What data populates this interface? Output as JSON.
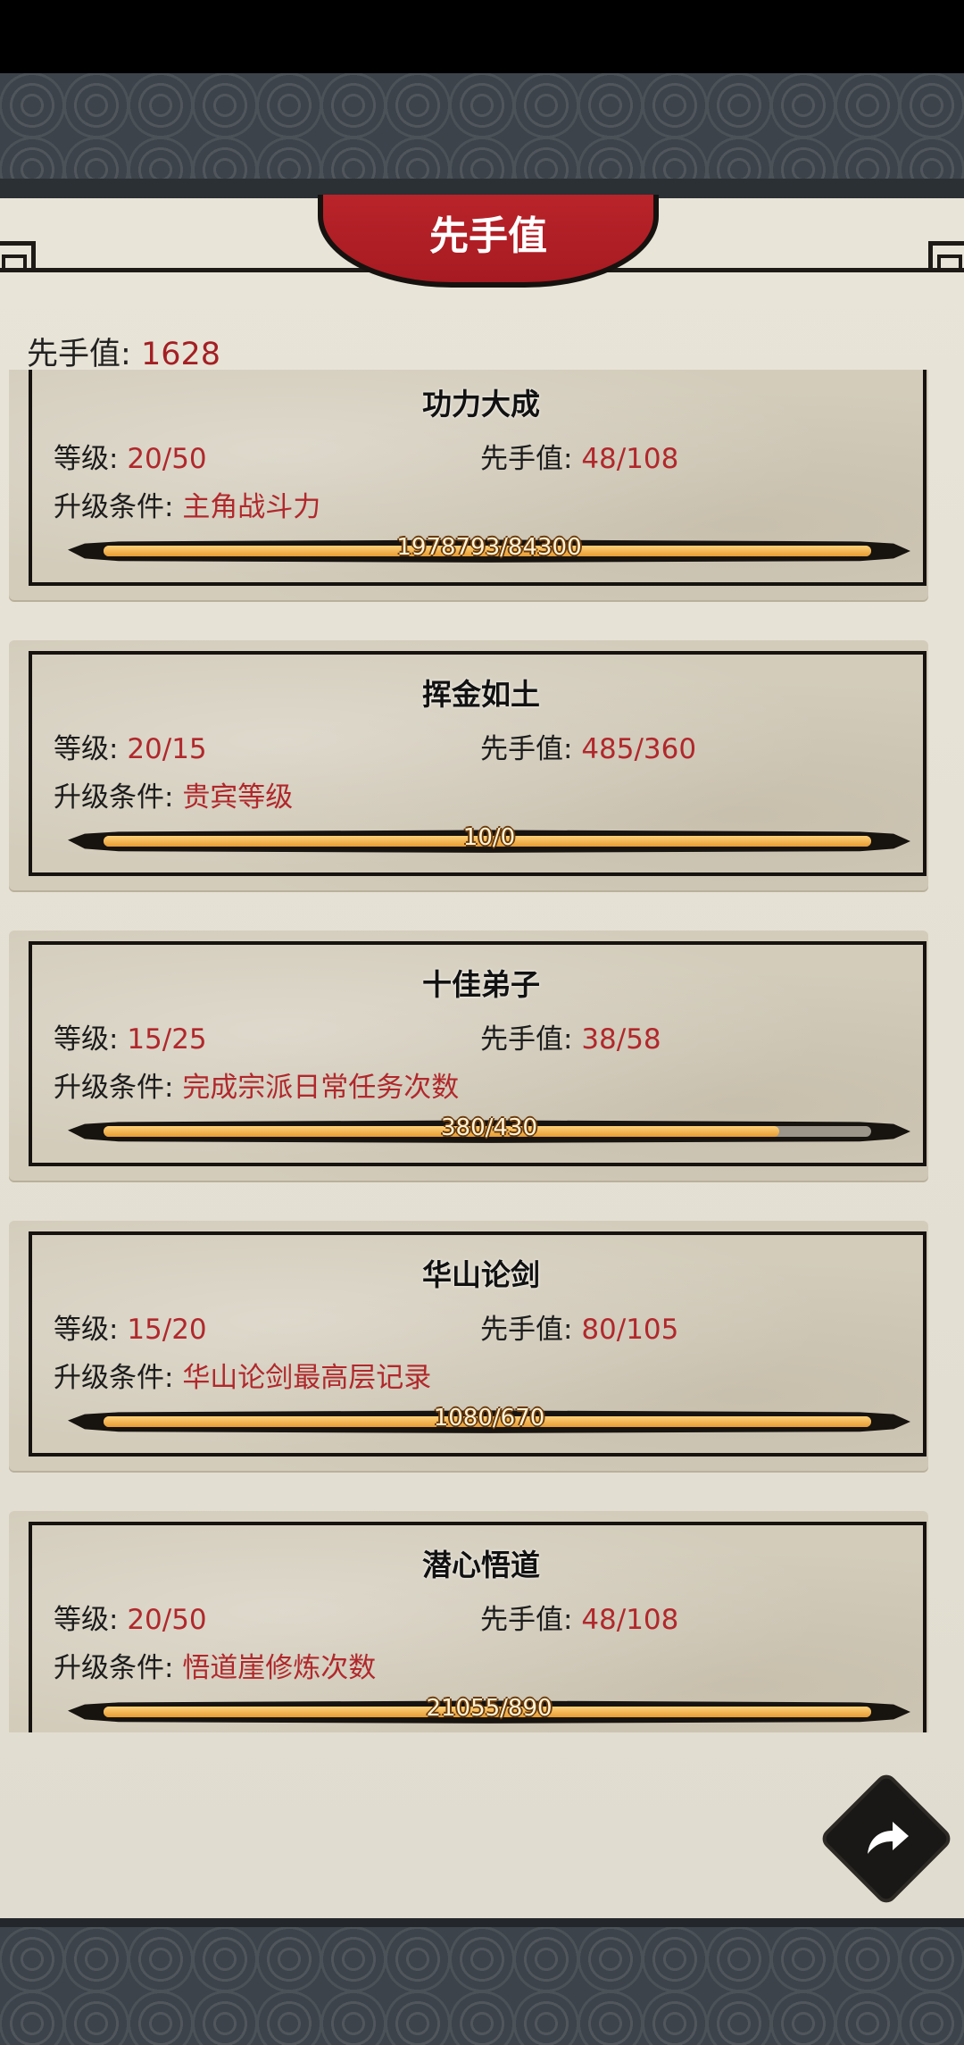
{
  "header": {
    "title": "先手值"
  },
  "summary": {
    "label": "先手值:",
    "value": "1628"
  },
  "cards": [
    {
      "title": "功力大成",
      "level_label": "等级:",
      "level": "20/50",
      "xs_label": "先手值:",
      "xs": "48/108",
      "cond_label": "升级条件:",
      "cond": "主角战斗力",
      "progress_text": "1978793/84300",
      "progress": 1.0
    },
    {
      "title": "挥金如土",
      "level_label": "等级:",
      "level": "20/15",
      "xs_label": "先手值:",
      "xs": "485/360",
      "cond_label": "升级条件:",
      "cond": "贵宾等级",
      "progress_text": "10/0",
      "progress": 1.0
    },
    {
      "title": "十佳弟子",
      "level_label": "等级:",
      "level": "15/25",
      "xs_label": "先手值:",
      "xs": "38/58",
      "cond_label": "升级条件:",
      "cond": "完成宗派日常任务次数",
      "progress_text": "380/430",
      "progress": 0.88
    },
    {
      "title": "华山论剑",
      "level_label": "等级:",
      "level": "15/20",
      "xs_label": "先手值:",
      "xs": "80/105",
      "cond_label": "升级条件:",
      "cond": "华山论剑最高层记录",
      "progress_text": "1080/670",
      "progress": 1.0
    },
    {
      "title": "潜心悟道",
      "level_label": "等级:",
      "level": "20/50",
      "xs_label": "先手值:",
      "xs": "48/108",
      "cond_label": "升级条件:",
      "cond": "悟道崖修炼次数",
      "progress_text": "21055/890",
      "progress": 1.0
    }
  ],
  "icons": {
    "back": "return-arrow-icon"
  },
  "colors": {
    "accent": "#b0282c",
    "title_tab": "#b9242a",
    "progress": "#f0a94a"
  }
}
